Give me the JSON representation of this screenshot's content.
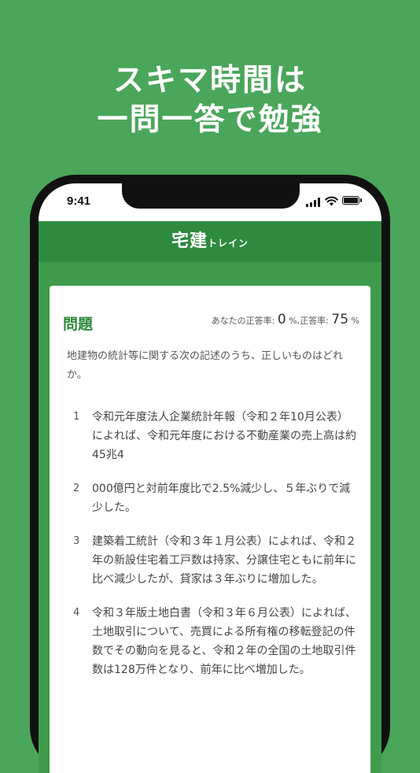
{
  "headline": {
    "line1": "スキマ時間は",
    "line2": "一問一答で勉強"
  },
  "status_bar": {
    "time": "9:41",
    "icons": [
      "cellular-signal-icon",
      "wifi-icon",
      "battery-icon"
    ]
  },
  "app_bar": {
    "logo_main": "宅建",
    "logo_sub": "トレイン"
  },
  "question_card": {
    "title": "問題",
    "your_rate_label": "あなたの正答率:",
    "your_rate_value": "0",
    "your_rate_unit": "%,",
    "overall_rate_label": "正答率:",
    "overall_rate_value": "75",
    "overall_rate_unit": "%",
    "question_text": "地建物の統計等に関する次の記述のうち、正しいものはどれか。",
    "choices": [
      {
        "number": "1",
        "text": "令和元年度法人企業統計年報（令和２年10月公表）によれば、令和元年度における不動産業の売上高は約45兆4"
      },
      {
        "number": "2",
        "text": "000億円と対前年度比で2.5%減少し、５年ぶりで減少した。"
      },
      {
        "number": "3",
        "text": "建築着工統計（令和３年１月公表）によれば、令和２年の新設住宅着工戸数は持家、分譲住宅ともに前年に比べ減少したが、貸家は３年ぶりに増加した。"
      },
      {
        "number": "4",
        "text": "令和３年版土地白書（令和３年６月公表）によれば、土地取引について、売買による所有権の移転登記の件数でその動向を見ると、令和２年の全国の土地取引件数は128万件となり、前年に比べ増加した。"
      }
    ]
  },
  "colors": {
    "background": "#4aa65a",
    "app_bar": "#2d8a3e",
    "title_green": "#2e8b3e"
  }
}
